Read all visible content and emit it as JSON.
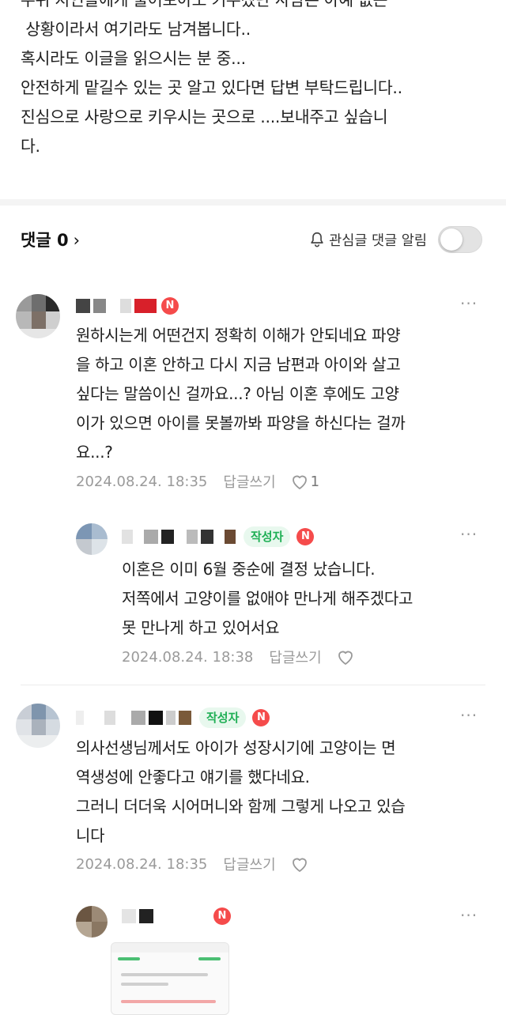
{
  "post": {
    "lines": [
      "주위 지인들에게 물어보아도 키우겠단 사람은 아예 없는",
      " 상황이라서 여기라도 남겨봅니다..",
      "혹시라도 이글을 읽으시는 분 중...",
      "안전하게 맡길수 있는 곳 알고 있다면 답변 부탁드립니다..",
      "진심으로 사랑으로 키우시는 곳으로 ....보내주고 싶습니",
      "다."
    ]
  },
  "comments_header": {
    "count_label": "댓글 0",
    "chevron": "›",
    "alarm_label": "관심글 댓글 알림",
    "alarm_icon": "bell-icon",
    "toggle_on": false
  },
  "comments": [
    {
      "badge_n": "N",
      "more": "···",
      "lines": [
        "원하시는게 어떤건지 정확히 이해가 안되네요 파양",
        "을 하고 이혼 안하고 다시 지금 남편과 아이와 살고",
        "싶다는 말씀이신 걸까요...? 아님 이혼 후에도 고양",
        "이가 있으면 아이를 못볼까봐 파양을 하신다는 걸까",
        "요...?"
      ],
      "date": "2024.08.24. 18:35",
      "reply_label": "답글쓰기",
      "likes": "1"
    },
    {
      "author_badge": "작성자",
      "badge_n": "N",
      "more": "···",
      "lines": [
        "이혼은 이미 6월 중순에 결정 났습니다.",
        "저쪽에서 고양이를 없애야 만나게 해주겠다고",
        "못 만나게 하고 있어서요"
      ],
      "date": "2024.08.24. 18:38",
      "reply_label": "답글쓰기"
    },
    {
      "author_badge": "작성자",
      "badge_n": "N",
      "more": "···",
      "lines": [
        "의사선생님께서도 아이가 성장시기에 고양이는 면",
        "역생성에 안좋다고 얘기를 했다네요.",
        "그러니 더더욱 시어머니와 함께 그렇게 나오고 있습",
        "니다"
      ],
      "date": "2024.08.24. 18:35",
      "reply_label": "답글쓰기"
    },
    {
      "badge_n": "N",
      "more": "···"
    }
  ],
  "colors": {
    "author_badge_bg": "#e8f8ee",
    "author_badge_text": "#1faf55",
    "new_badge": "#f54b4b",
    "meta_text": "#9a9a9a"
  }
}
